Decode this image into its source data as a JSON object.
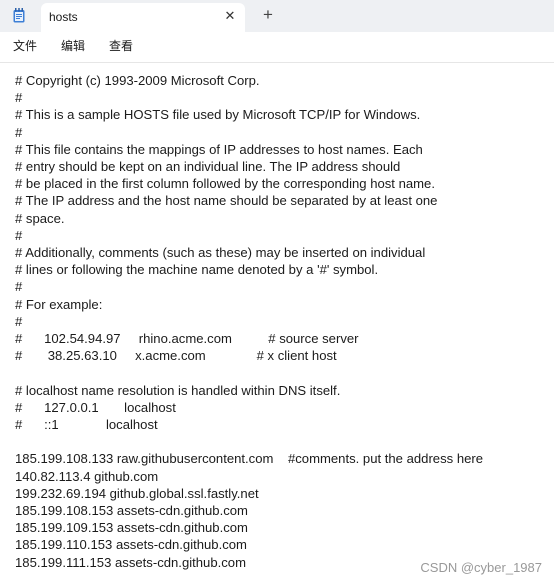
{
  "tab": {
    "title": "hosts"
  },
  "icons": {
    "app": "notepad-icon",
    "close": "close-icon",
    "new_tab": "plus-icon"
  },
  "glyphs": {
    "close": "✕",
    "plus": "+"
  },
  "menu": [
    "文件",
    "编辑",
    "查看"
  ],
  "content": {
    "lines": [
      "# Copyright (c) 1993-2009 Microsoft Corp.",
      "#",
      "# This is a sample HOSTS file used by Microsoft TCP/IP for Windows.",
      "#",
      "# This file contains the mappings of IP addresses to host names. Each",
      "# entry should be kept on an individual line. The IP address should",
      "# be placed in the first column followed by the corresponding host name.",
      "# The IP address and the host name should be separated by at least one",
      "# space.",
      "#",
      "# Additionally, comments (such as these) may be inserted on individual",
      "# lines or following the machine name denoted by a '#' symbol.",
      "#",
      "# For example:",
      "#",
      "#      102.54.94.97     rhino.acme.com          # source server",
      "#       38.25.63.10     x.acme.com              # x client host",
      "",
      "# localhost name resolution is handled within DNS itself.",
      "#      127.0.0.1       localhost",
      "#      ::1             localhost",
      "",
      "185.199.108.133 raw.githubusercontent.com    #comments. put the address here",
      "140.82.113.4 github.com",
      "199.232.69.194 github.global.ssl.fastly.net",
      "185.199.108.153 assets-cdn.github.com",
      "185.199.109.153 assets-cdn.github.com",
      "185.199.110.153 assets-cdn.github.com",
      "185.199.111.153 assets-cdn.github.com"
    ]
  },
  "watermark": "CSDN @cyber_1987"
}
